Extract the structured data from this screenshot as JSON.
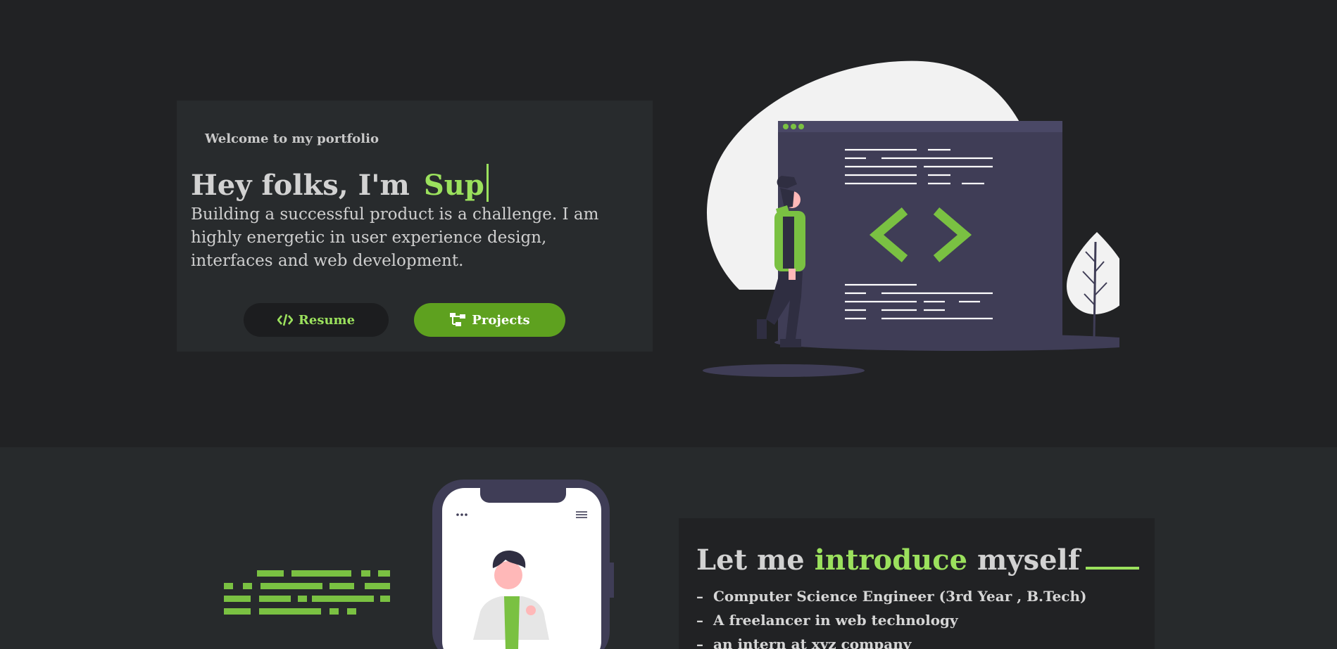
{
  "hero": {
    "welcome": "Welcome to my portfolio",
    "headline_prefix": "Hey folks, I'm",
    "headline_typed": "Sup",
    "bio": "Building a successful product is a challenge. I am highly energetic in user experience design, interfaces and web development.",
    "buttons": {
      "resume_label": "Resume",
      "projects_label": "Projects"
    }
  },
  "about": {
    "title_part1": "Let me",
    "title_highlight": "introduce",
    "title_part2": "myself",
    "items": [
      "Computer Science Engineer (3rd Year , B.Tech)",
      "A freelancer in web technology",
      "an intern at xyz company"
    ],
    "bullet": "–"
  },
  "colors": {
    "background": "#212224",
    "section_alt": "#272a2c",
    "card": "#282b2d",
    "accent": "#9be15d",
    "button_green": "#5ea11f",
    "illustration_purple": "#3f3d56"
  },
  "icons": {
    "resume": "code-icon",
    "projects": "sitemap-icon"
  }
}
